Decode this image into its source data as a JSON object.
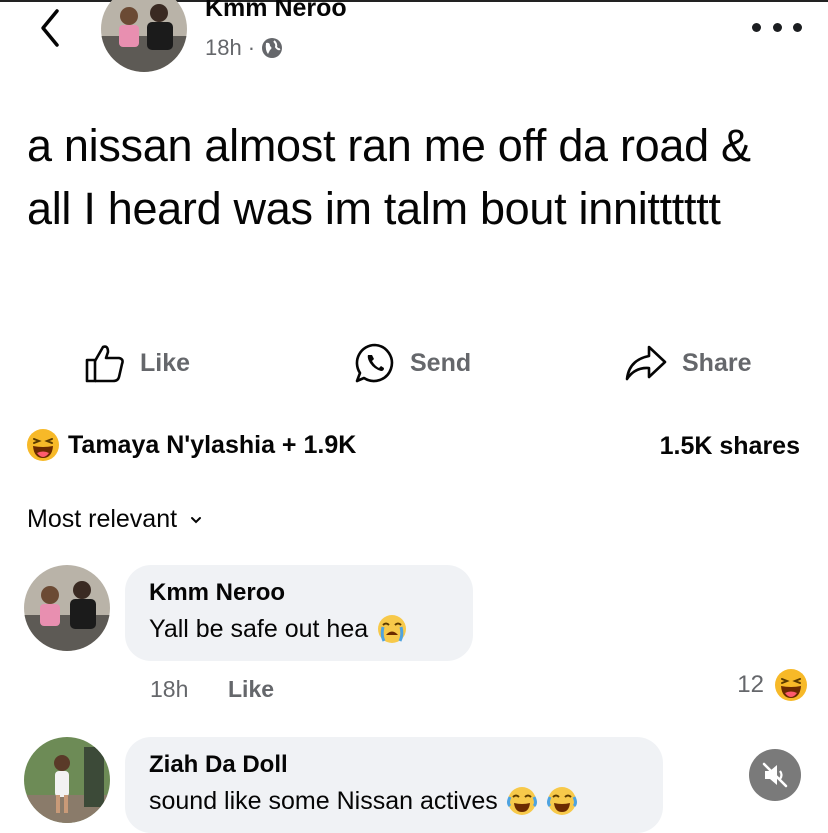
{
  "post": {
    "author": "Kmm Neroo",
    "time": "18h",
    "separator": "·",
    "text": "a nissan almost ran me off da road & all I heard was im talm bout innitttttt"
  },
  "actions": {
    "like": "Like",
    "send": "Send",
    "share": "Share"
  },
  "summary": {
    "reactors": "Tamaya N'ylashia + 1.9K",
    "shares": "1.5K shares"
  },
  "sort": {
    "label": "Most relevant"
  },
  "comments": [
    {
      "author": "Kmm Neroo",
      "text": "Yall be safe out hea",
      "emoji": "crying-face-icon",
      "time": "18h",
      "like": "Like",
      "reaction_count": "12",
      "reaction_icon": "haha-reaction-icon"
    },
    {
      "author": "Ziah Da Doll",
      "text": "sound like some Nissan actives",
      "emoji": "tears-of-joy-icon"
    }
  ],
  "colors": {
    "text": "#050505",
    "secondary": "#65676b",
    "bubble": "#f0f2f5",
    "reaction": "#f7b928"
  }
}
